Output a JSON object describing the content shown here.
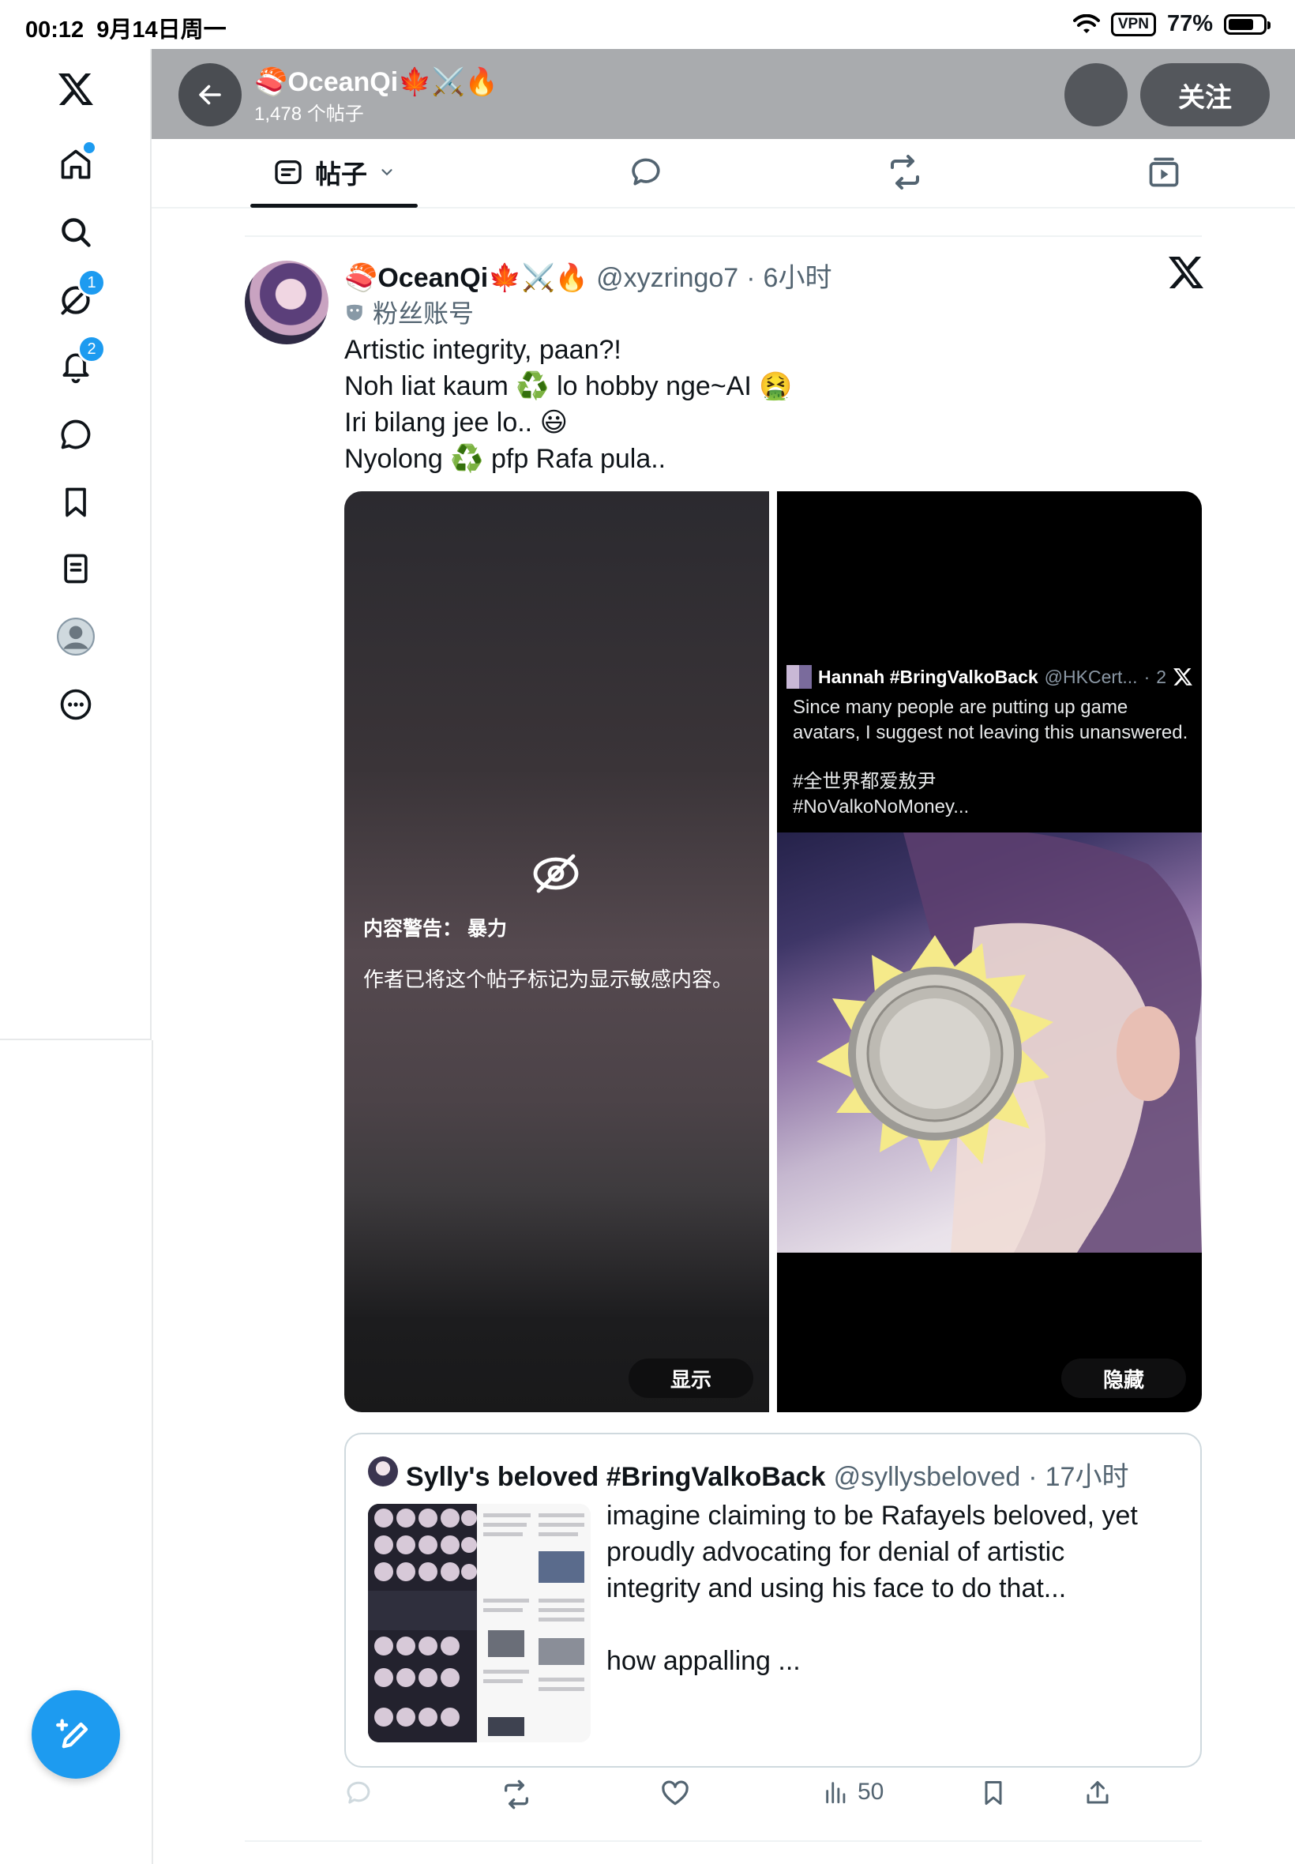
{
  "status_bar": {
    "time": "00:12",
    "date": "9月14日周一",
    "vpn": "VPN",
    "battery": "77%",
    "battery_level": 0.77
  },
  "sidebar": {
    "items": [
      {
        "icon": "x-logo-icon"
      },
      {
        "icon": "home-icon"
      },
      {
        "icon": "search-icon"
      },
      {
        "icon": "grok-icon",
        "badge": "1"
      },
      {
        "icon": "bell-icon",
        "badge": "2"
      },
      {
        "icon": "chat-icon"
      },
      {
        "icon": "bookmark-icon"
      },
      {
        "icon": "lists-icon"
      },
      {
        "icon": "profile-icon"
      },
      {
        "icon": "more-icon"
      }
    ]
  },
  "header": {
    "name": "🍣OceanQi🍁⚔️🔥",
    "post_count": "1,478 个帖子",
    "follow_label": "关注"
  },
  "tabs": {
    "posts_label": "帖子",
    "icons": [
      "posts-icon",
      "reply-icon",
      "repost-icon",
      "media-icon"
    ]
  },
  "post": {
    "author_name": "🍣OceanQi🍁⚔️🔥",
    "handle": "@xyzringo7",
    "time": "6小时",
    "account_label": "粉丝账号",
    "lines": [
      "Artistic integrity, paan?!",
      "Noh liat kaum ♻️ lo hobby nge~AI 🤮",
      "Iri bilang jee lo.. 😃",
      "Nyolong ♻️ pfp Rafa pula.."
    ],
    "media_warning": {
      "title": "内容警告： 暴力",
      "description": "作者已将这个帖子标记为显示敏感内容。",
      "show_label": "显示",
      "hide_label": "隐藏"
    },
    "embedded_screenshot": {
      "name": "Hannah #BringValkoBack",
      "handle": "@HKCert...",
      "time": "2",
      "text": "Since many people are putting up game avatars, I suggest not leaving this unanswered.",
      "tags": [
        "#全世界都爱敖尹",
        "#NoValkoNoMoney..."
      ]
    },
    "quote": {
      "name": "Sylly's beloved #BringValkoBack",
      "handle": "@syllysbeloved",
      "time": "17小时",
      "text_lines": [
        "imagine claiming to be Rafayels beloved, yet",
        "proudly advocating for denial of artistic",
        "integrity and using his face to do that...",
        "",
        "how appalling ..."
      ]
    },
    "actions": {
      "views": "50"
    }
  },
  "colors": {
    "accent": "#1d9bf0",
    "text": "#0f1419",
    "muted": "#536471",
    "header_bg": "#a9abae"
  }
}
